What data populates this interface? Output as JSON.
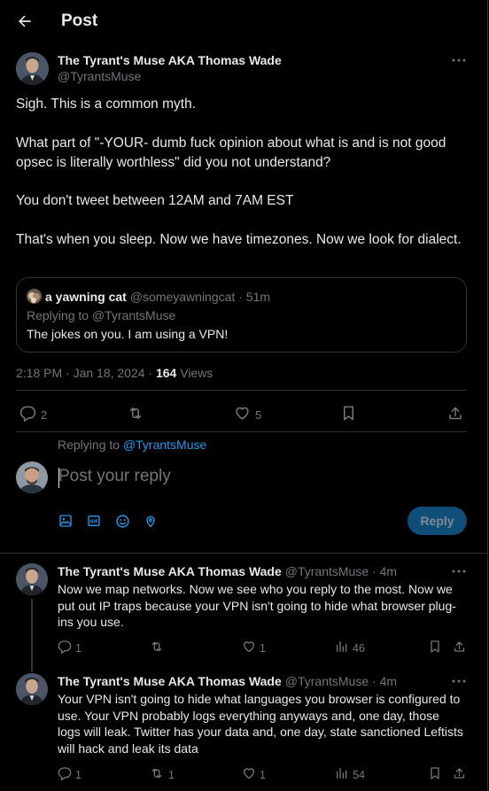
{
  "header": {
    "title": "Post"
  },
  "post": {
    "author_name": "The Tyrant's Muse AKA Thomas Wade",
    "author_handle": "@TyrantsMuse",
    "paragraphs": [
      "Sigh. This is a common myth.",
      "What part of \"-YOUR- dumb fuck opinion about what is and is not good opsec is literally worthless\" did you not understand?",
      "You don't tweet between 12AM and 7AM EST",
      "That's when you sleep.  Now we have timezones. Now we look for dialect."
    ],
    "quote": {
      "author_name": "a yawning cat",
      "author_handle": "@someyawningcat",
      "time": "· 51m",
      "replying": "Replying to @TyrantsMuse",
      "text": "The jokes on you. I am using a VPN!"
    },
    "timestamp": "2:18 PM · Jan 18, 2024 · ",
    "views_count": "164",
    "views_label": " Views",
    "stats": {
      "replies": "2",
      "likes": "5"
    }
  },
  "composer": {
    "replying_prefix": "Replying to ",
    "replying_handle": "@TyrantsMuse",
    "placeholder": "Post your reply",
    "reply_button": "Reply"
  },
  "replies": [
    {
      "author_name": "The Tyrant's Muse AKA Thomas Wade",
      "author_handle": "@TyrantsMuse · 4m",
      "text": "Now we map networks.  Now we see who you reply to the most.  Now we put out IP traps because your VPN isn't going to hide what browser plug-ins you use.",
      "replies": "1",
      "retweets": "",
      "likes": "1",
      "views": "46"
    },
    {
      "author_name": "The Tyrant's Muse AKA Thomas Wade",
      "author_handle": "@TyrantsMuse · 4m",
      "text": "Your VPN isn't going to hide what languages you browser is configured to use.  Your VPN probably logs everything anyways and, one day, those logs will leak.  Twitter has your data and, one day, state sanctioned Leftists will hack and leak its data",
      "replies": "1",
      "retweets": "1",
      "likes": "1",
      "views": "54"
    }
  ],
  "colors": {
    "accent": "#1d9bf0",
    "muted": "#71767b",
    "text": "#e7e9ea",
    "border": "#2f3336"
  }
}
